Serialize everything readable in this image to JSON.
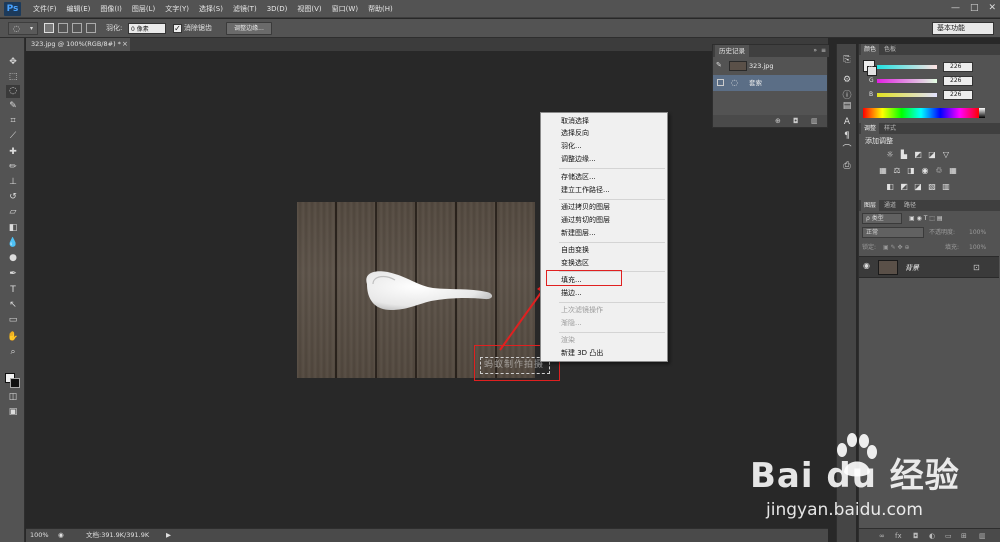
{
  "app": {
    "logo": "Ps"
  },
  "menu": [
    "文件(F)",
    "编辑(E)",
    "图像(I)",
    "图层(L)",
    "文字(Y)",
    "选择(S)",
    "滤镜(T)",
    "3D(D)",
    "视图(V)",
    "窗口(W)",
    "帮助(H)"
  ],
  "options": {
    "feather_label": "羽化:",
    "feather_value": "0 像素",
    "antialias_label": "消除锯齿",
    "refine_edge": "调整边缘...",
    "workspace": "基本功能"
  },
  "document": {
    "tab_title": "323.jpg @ 100%(RGB/8#) *",
    "watermark_text": "蚂蚁制作拍摄"
  },
  "context_menu": {
    "items": [
      {
        "label": "取消选择"
      },
      {
        "label": "选择反向"
      },
      {
        "label": "羽化..."
      },
      {
        "label": "调整边缘..."
      },
      {
        "label": "存储选区..."
      },
      {
        "label": "建立工作路径..."
      },
      {
        "label": "通过拷贝的图层"
      },
      {
        "label": "通过剪切的图层"
      },
      {
        "label": "新建图层..."
      },
      {
        "label": "自由变换"
      },
      {
        "label": "变换选区"
      },
      {
        "label": "填充..."
      },
      {
        "label": "描边..."
      },
      {
        "label": "上次滤镜操作"
      },
      {
        "label": "渐隐..."
      },
      {
        "label": "渲染"
      },
      {
        "label": "新建 3D 凸出"
      }
    ]
  },
  "status": {
    "zoom": "100%",
    "doc_size": "文档:391.9K/391.9K"
  },
  "history": {
    "tab": "历史记录",
    "snapshot": "323.jpg",
    "step": "套索"
  },
  "color_panel": {
    "tabs": [
      "颜色",
      "色板"
    ],
    "channels": [
      {
        "label": "R",
        "value": "226"
      },
      {
        "label": "G",
        "value": "226"
      },
      {
        "label": "B",
        "value": "226"
      }
    ]
  },
  "adjust_panel": {
    "tabs": [
      "调整",
      "样式"
    ],
    "title": "添加调整"
  },
  "layers_panel": {
    "tabs": [
      "图层",
      "通道",
      "路径"
    ],
    "kind_filter": "ρ 类型",
    "blend_mode": "正常",
    "opacity_label": "不透明度:",
    "opacity_value": "100%",
    "lock_label": "锁定:",
    "fill_label": "填充:",
    "fill_value": "100%",
    "layer_name": "背景"
  },
  "baidu": {
    "word": "Bai du 经验",
    "url": "jingyan.baidu.com"
  },
  "colors": {
    "accent_red": "#e02020",
    "panel_bg": "#535353",
    "canvas_bg": "#282828"
  }
}
